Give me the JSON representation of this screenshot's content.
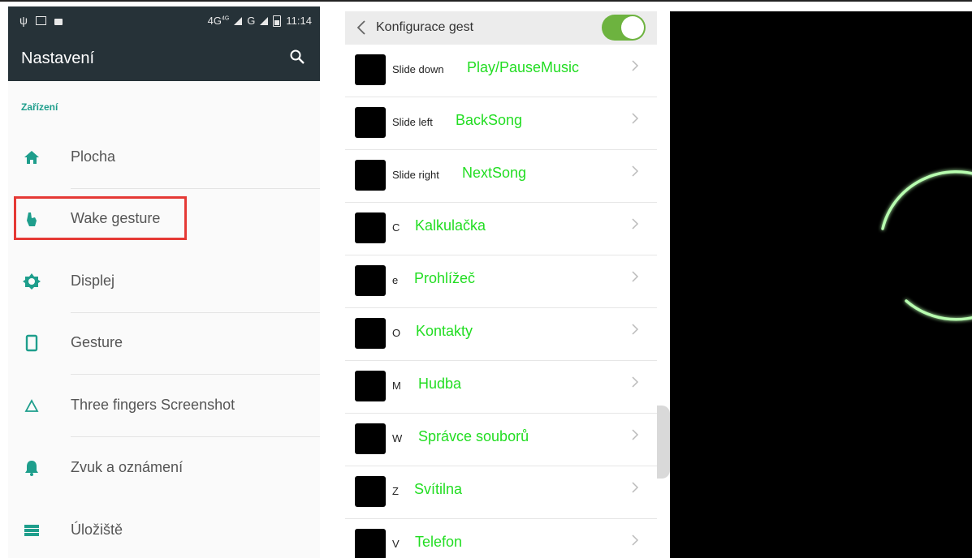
{
  "settings": {
    "status": {
      "network": "4G",
      "network_sup": "4G",
      "network2": "G",
      "time": "11:14"
    },
    "title": "Nastavení",
    "section": "Zařízení",
    "items": [
      {
        "label": "Plocha",
        "icon": "home-icon"
      },
      {
        "label": "Wake gesture",
        "icon": "hand-icon"
      },
      {
        "label": "Displej",
        "icon": "brightness-icon"
      },
      {
        "label": "Gesture",
        "icon": "phone-icon"
      },
      {
        "label": "Three fingers Screenshot",
        "icon": "triangle-icon"
      },
      {
        "label": "Zvuk a oznámení",
        "icon": "bell-icon"
      },
      {
        "label": "Úložiště",
        "icon": "storage-icon"
      }
    ]
  },
  "gestures": {
    "title": "Konfigurace gest",
    "enabled": true,
    "rows": [
      {
        "gesture": "Slide down",
        "action": "Play/PauseMusic"
      },
      {
        "gesture": "Slide left",
        "action": "BackSong"
      },
      {
        "gesture": "Slide right",
        "action": "NextSong"
      },
      {
        "gesture": "C",
        "action": "Kalkulačka"
      },
      {
        "gesture": "e",
        "action": "Prohlížeč"
      },
      {
        "gesture": "O",
        "action": "Kontakty"
      },
      {
        "gesture": "M",
        "action": "Hudba"
      },
      {
        "gesture": "W",
        "action": "Správce souborů"
      },
      {
        "gesture": "Z",
        "action": "Svítilna"
      },
      {
        "gesture": "V",
        "action": "Telefon"
      }
    ]
  },
  "colors": {
    "accent": "#1e9e8c",
    "toolbar": "#263238",
    "action_green": "#22dd22",
    "toggle": "#6db33f",
    "glow": "#b8ffb0"
  }
}
